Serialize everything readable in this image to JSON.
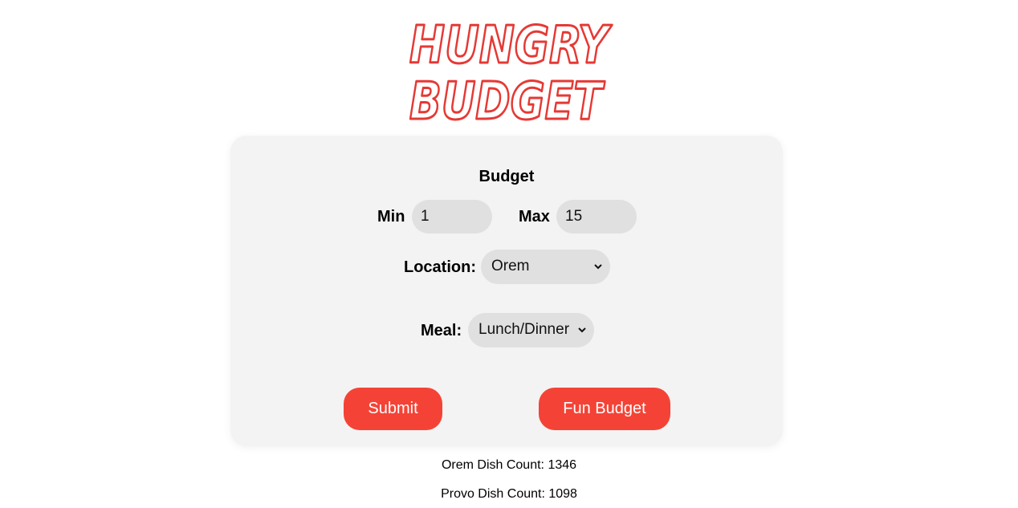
{
  "logo": {
    "line1": "HUNGRY",
    "line2": "BUDGET",
    "color": "#e53935"
  },
  "form": {
    "budget_title": "Budget",
    "min_label": "Min",
    "min_value": "1",
    "max_label": "Max",
    "max_value": "15",
    "location_label": "Location:",
    "location_value": "Orem",
    "meal_label": "Meal:",
    "meal_value": "Lunch/Dinner"
  },
  "buttons": {
    "submit_label": "Submit",
    "fun_budget_label": "Fun Budget",
    "color": "#f44336"
  },
  "counts": {
    "orem": "Orem Dish Count: 1346",
    "provo": "Provo Dish Count: 1098"
  }
}
